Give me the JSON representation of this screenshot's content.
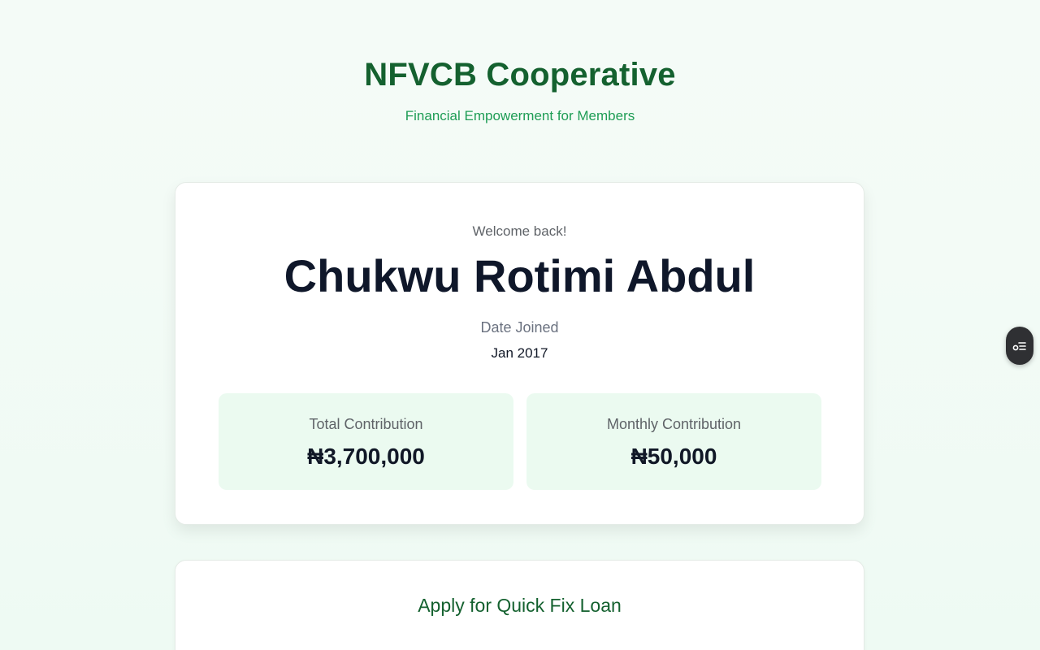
{
  "header": {
    "title": "NFVCB Cooperative",
    "subtitle": "Financial Empowerment for Members"
  },
  "profile": {
    "welcome": "Welcome back!",
    "name": "Chukwu Rotimi Abdul",
    "date_joined_label": "Date Joined",
    "date_joined_value": "Jan 2017"
  },
  "stats": [
    {
      "label": "Total Contribution",
      "value": "₦3,700,000"
    },
    {
      "label": "Monthly Contribution",
      "value": "₦50,000"
    }
  ],
  "loan": {
    "title": "Apply for Quick Fix Loan"
  },
  "floating_button": {
    "icon": "settings-toggle-icon"
  },
  "colors": {
    "brand_green": "#14612f",
    "accent_green": "#1f9d55",
    "stat_bg": "#ebfaf0"
  }
}
